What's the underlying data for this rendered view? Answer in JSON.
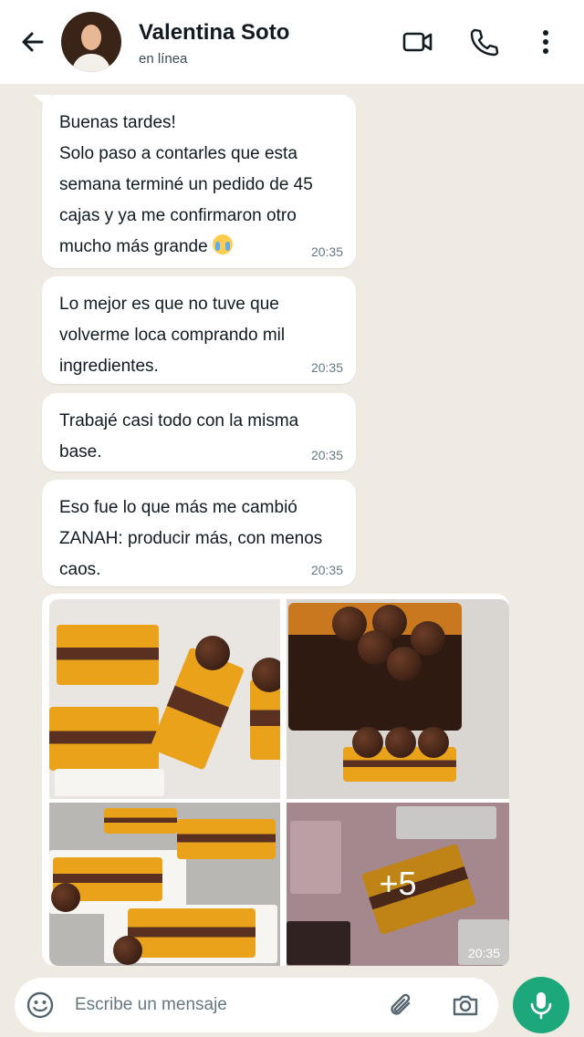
{
  "header": {
    "contact_name": "Valentina Soto",
    "status": "en línea"
  },
  "messages": [
    {
      "lines": [
        "Buenas tardes!",
        "Solo paso a contarles que esta",
        "semana terminé un pedido de 45",
        "cajas y ya me confirmaron otro",
        "mucho más grande"
      ],
      "time": "20:35",
      "emoji": "crying-face"
    },
    {
      "lines": [
        "Lo mejor es que no tuve que",
        "volverme loca comprando mil",
        "ingredientes."
      ],
      "time": "20:35"
    },
    {
      "lines": [
        "Trabajé casi todo con la misma",
        "base."
      ],
      "time": "20:35"
    },
    {
      "lines": [
        "Eso fue lo que más me cambió",
        "ZANAH: producir más, con menos",
        "caos."
      ],
      "time": "20:35"
    }
  ],
  "media": {
    "more_count": "+5",
    "time": "20:35"
  },
  "composer": {
    "placeholder": "Escribe un mensaje"
  },
  "colors": {
    "chat_background": "#efeae2",
    "bubble": "#ffffff",
    "mic_button": "#1da87b"
  }
}
